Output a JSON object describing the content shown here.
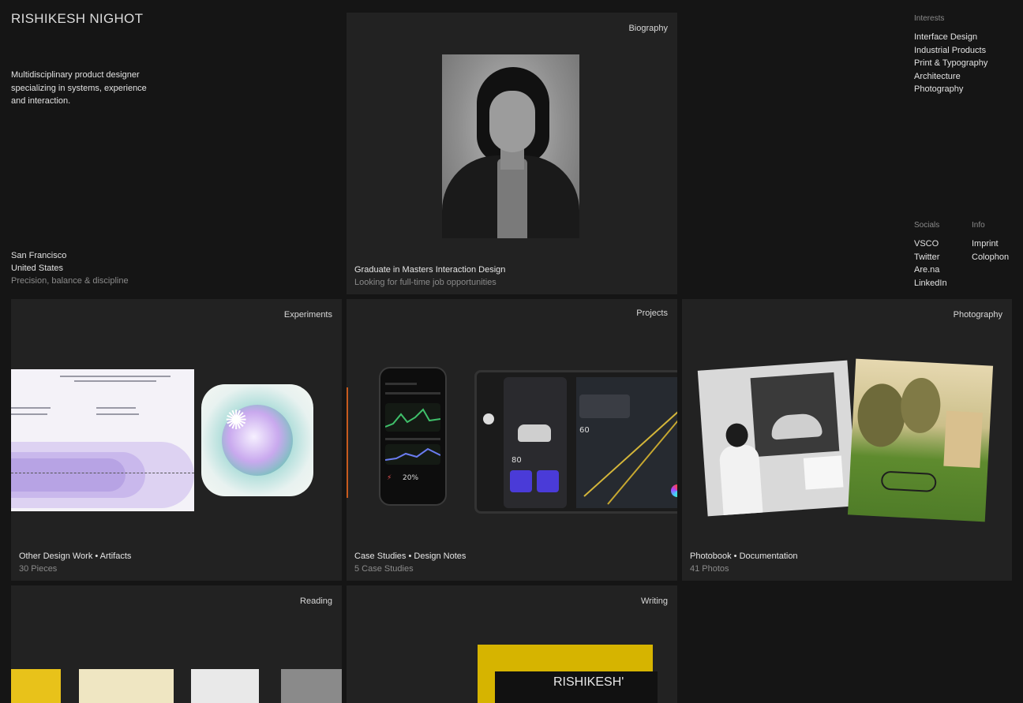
{
  "intro": {
    "name": "RISHIKESH NIGHOT",
    "tagline": "Multidisciplinary product designer specializing in systems, experience and interaction.",
    "city": "San Francisco",
    "country": "United States",
    "motto": "Precision, balance & discipline"
  },
  "interests": {
    "heading": "Interests",
    "items": [
      "Interface Design",
      "Industrial Products",
      "Print & Typography",
      "Architecture",
      "Photography"
    ]
  },
  "socials": {
    "heading": "Socials",
    "items": [
      "VSCO",
      "Twitter",
      "Are.na",
      "LinkedIn"
    ]
  },
  "info": {
    "heading": "Info",
    "items": [
      "Imprint",
      "Colophon"
    ]
  },
  "cards": {
    "biography": {
      "tag": "Biography",
      "title": "Graduate in Masters Interaction Design",
      "subtitle": "Looking for full-time job opportunities"
    },
    "experiments": {
      "tag": "Experiments",
      "title": "Other Design Work • Artifacts",
      "subtitle": "30 Pieces"
    },
    "projects": {
      "tag": "Projects",
      "title": "Case Studies • Design Notes",
      "subtitle": "5 Case Studies",
      "phone_stat": "20%",
      "tablet_speed": "80",
      "tablet_temp": "60"
    },
    "photography": {
      "tag": "Photography",
      "title": "Photobook • Documentation",
      "subtitle": "41 Photos"
    },
    "reading": {
      "tag": "Reading"
    },
    "writing": {
      "tag": "Writing",
      "logo_text": "RISHIKESH'"
    }
  },
  "colors": {
    "background": "#151515",
    "card": "#222222",
    "muted_text": "#8a8a8a",
    "writing_yellow": "#d6b400",
    "terminal_green": "#6fae58"
  }
}
